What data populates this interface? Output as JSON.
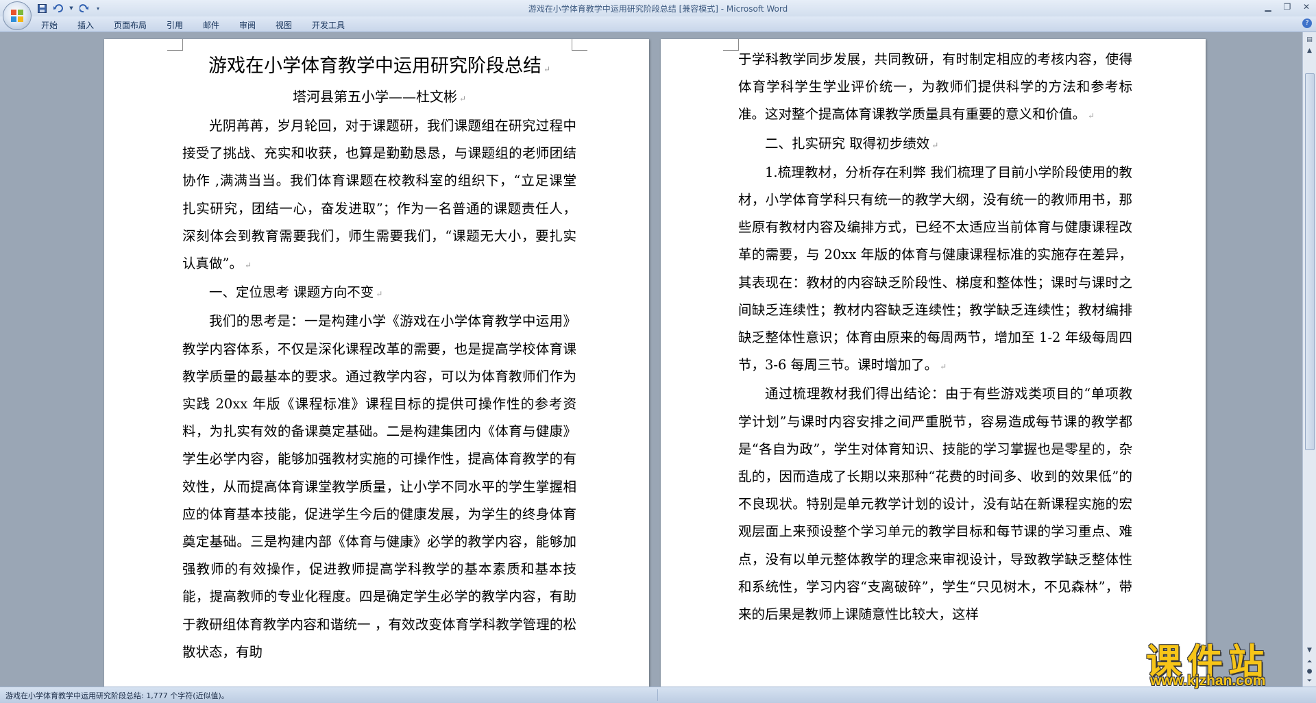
{
  "window": {
    "title": "游戏在小学体育教学中运用研究阶段总结 [兼容模式] - Microsoft Word"
  },
  "quick_access": {
    "items": [
      "save-icon",
      "undo-icon",
      "redo-icon",
      "customize-icon"
    ]
  },
  "ribbon": {
    "tabs": [
      "开始",
      "插入",
      "页面布局",
      "引用",
      "邮件",
      "审阅",
      "视图",
      "开发工具"
    ]
  },
  "document": {
    "title": "游戏在小学体育教学中运用研究阶段总结",
    "author": "塔河县第五小学——杜文彬",
    "page1": [
      "光阴苒苒，岁月轮回，对于课题研，我们课题组在研究过程中接受了挑战、充实和收获，也算是勤勤恳恳，与课题组的老师团结协作 ,满满当当。我们体育课题在校教科室的组织下，“立足课堂　扎实研究，团结一心，奋发进取”；作为一名普通的课题责任人，深刻体会到教育需要我们，师生需要我们，“课题无大小，要扎实认真做”。",
      "一、定位思考 课题方向不变",
      "我们的思考是：一是构建小学《游戏在小学体育教学中运用》教学内容体系，不仅是深化课程改革的需要，也是提高学校体育课教学质量的最基本的要求。通过教学内容，可以为体育教师们作为实践 20xx 年版《课程标准》课程目标的提供可操作性的参考资料，为扎实有效的备课奠定基础。二是构建集团内《体育与健康》学生必学内容，能够加强教材实施的可操作性，提高体育教学的有效性，从而提高体育课堂教学质量，让小学不同水平的学生掌握相应的体育基本技能，促进学生今后的健康发展，为学生的终身体育奠定基础。三是构建内部《体育与健康》必学的教学内容，能够加强教师的有效操作，促进教师提高学科教学的基本素质和基本技能，提高教师的专业化程度。四是确定学生必学的教学内容，有助于教研组体育教学内容和谐统一 ，有效改变体育学科教学管理的松散状态，有助"
    ],
    "page2": [
      "于学科教学同步发展，共同教研，有时制定相应的考核内容，使得体育学科学生学业评价统一，为教师们提供科学的方法和参考标准。这对整个提高体育课教学质量具有重要的意义和价值。",
      "二、扎实研究 取得初步绩效",
      "1.梳理教材，分析存在利弊 我们梳理了目前小学阶段使用的教材，小学体育学科只有统一的教学大纲，没有统一的教师用书，那些原有教材内容及编排方式，已经不太适应当前体育与健康课程改革的需要，与 20xx 年版的体育与健康课程标准的实施存在差异，其表现在：教材的内容缺乏阶段性、梯度和整体性；课时与课时之间缺乏连续性；教材内容缺乏连续性；教学缺乏连续性；教材编排缺乏整体性意识；体育由原来的每周两节，增加至 1-2 年级每周四节，3-6 每周三节。课时增加了。",
      "通过梳理教材我们得出结论：由于有些游戏类项目的“单项教学计划”与课时内容安排之间严重脱节，容易造成每节课的教学都是“各自为政”，学生对体育知识、技能的学习掌握也是零星的，杂乱的，因而造成了长期以来那种“花费的时间多、收到的效果低”的不良现状。特别是单元教学计划的设计，没有站在新课程实施的宏观层面上来预设整个学习单元的教学目标和每节课的学习重点、难点，没有以单元整体教学的理念来审视设计，导致教学缺乏整体性和系统性，学习内容“支离破碎”，学生“只见树木，不见森林”，带来的后果是教师上课随意性比较大，这样"
    ]
  },
  "status_bar": {
    "text": "游戏在小学体育教学中运用研究阶段总结: 1,777 个字符(近似值)。"
  },
  "watermark": {
    "text": "课件站",
    "url": "www.kjzhan.com"
  },
  "colors": {
    "title_text": "#3d5a80",
    "ribbon_bg": "#c8d6ea",
    "workspace_bg": "#9aa6b5",
    "watermark": "#f7c518"
  }
}
